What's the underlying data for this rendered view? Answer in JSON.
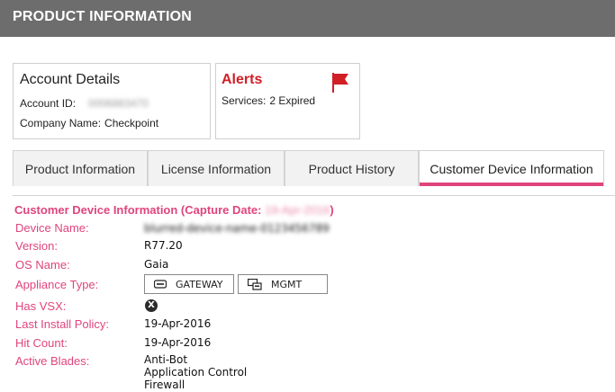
{
  "header": {
    "title": "PRODUCT INFORMATION"
  },
  "account": {
    "heading": "Account Details",
    "id_label": "Account ID:",
    "id_value": "0006883470",
    "company_label": "Company Name:",
    "company_value": "Checkpoint"
  },
  "alerts": {
    "heading": "Alerts",
    "services_label": "Services:",
    "services_value": "2 Expired",
    "flag_color": "#d11f26"
  },
  "tabs": [
    {
      "label": "Product Information",
      "active": false
    },
    {
      "label": "License Information",
      "active": false
    },
    {
      "label": "Product History",
      "active": false
    },
    {
      "label": "Customer Device Information",
      "active": true
    }
  ],
  "device": {
    "section_title": "Customer Device Information (Capture Date:",
    "capture_date": "19-Apr-2016",
    "section_close": ")",
    "fields": [
      {
        "label": "Device Name:",
        "value": "blurred-device-name-0123456789"
      },
      {
        "label": "Version:",
        "value": "R77.20"
      },
      {
        "label": "OS Name:",
        "value": "Gaia"
      },
      {
        "label": "Appliance Type:",
        "value": ""
      },
      {
        "label": "Has VSX:",
        "value": ""
      },
      {
        "label": "Last Install Policy:",
        "value": "19-Apr-2016"
      },
      {
        "label": "Hit Count:",
        "value": "19-Apr-2016"
      },
      {
        "label": "Active Blades:",
        "value": ""
      }
    ],
    "appliance_types": [
      {
        "label": "GATEWAY",
        "icon": "gateway-icon"
      },
      {
        "label": "MGMT",
        "icon": "management-icon"
      }
    ],
    "vsx_glyph": "X",
    "active_blades": [
      "Anti-Bot",
      "Application Control",
      "Firewall"
    ]
  },
  "colors": {
    "accent": "#e0447c",
    "header_bg": "#6d6d6d",
    "alert": "#d11f26"
  }
}
